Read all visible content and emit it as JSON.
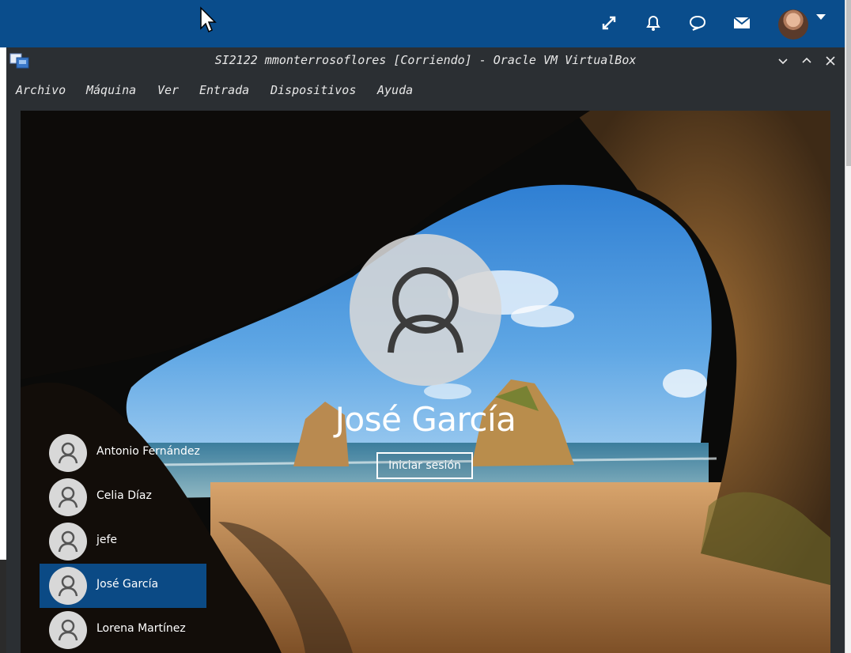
{
  "host": {
    "icons": [
      "expand-icon",
      "bell-icon",
      "chat-bubble-icon",
      "mail-icon"
    ]
  },
  "vbox": {
    "title": "SI2122 mmonterrosoflores [Corriendo] - Oracle VM VirtualBox",
    "menu": [
      "Archivo",
      "Máquina",
      "Ver",
      "Entrada",
      "Dispositivos",
      "Ayuda"
    ]
  },
  "login": {
    "username": "José García",
    "signin_label": "Iniciar sesión",
    "users": [
      {
        "name": "Antonio Fernández",
        "selected": false
      },
      {
        "name": "Celia Díaz",
        "selected": false
      },
      {
        "name": "jefe",
        "selected": false
      },
      {
        "name": "José García",
        "selected": true
      },
      {
        "name": "Lorena Martínez",
        "selected": false
      }
    ]
  },
  "colors": {
    "host_bar": "#0a4d8c",
    "vbox_chrome": "#2b2f33",
    "selected_user": "#0b4a85"
  }
}
